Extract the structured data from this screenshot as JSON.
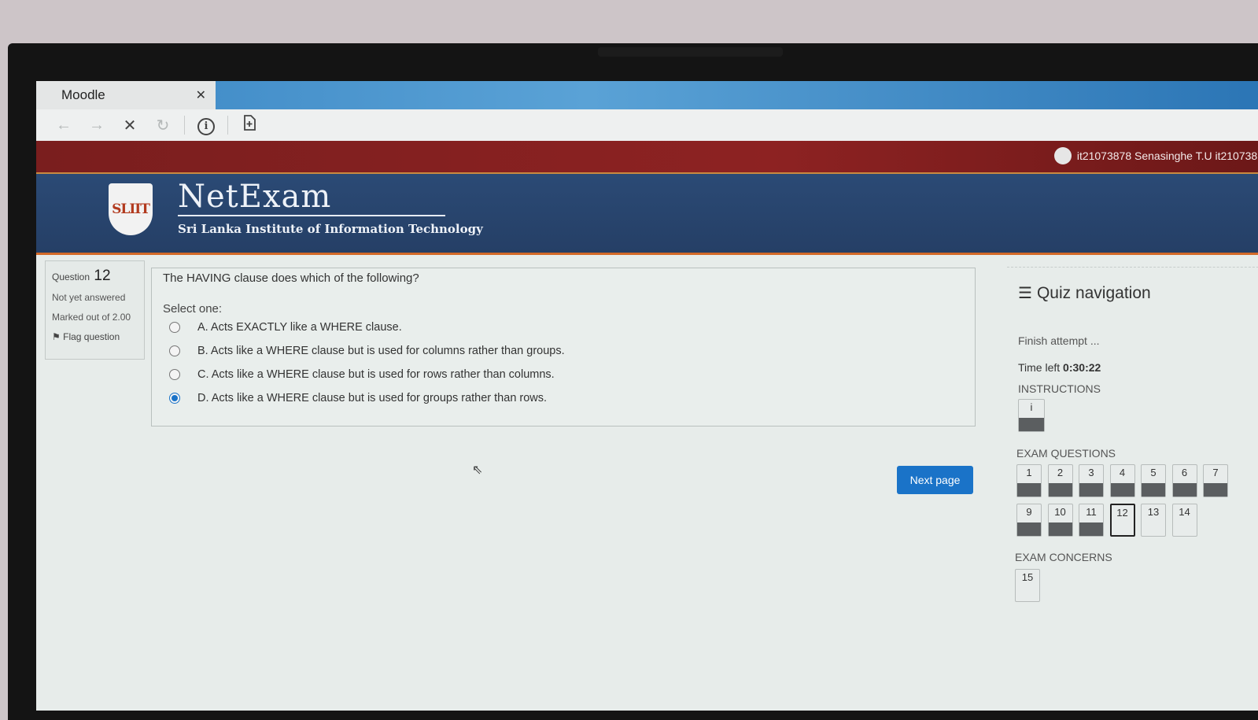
{
  "browser": {
    "tab_title": "Moodle",
    "tab_close": "✕",
    "nav_icons": [
      "back-arrow-icon",
      "forward-arrow-icon",
      "stop-icon",
      "reload-icon",
      "info-icon",
      "page-icon"
    ]
  },
  "header": {
    "user": "it21073878 Senasinghe T.U it2107387",
    "brand": "NetExam",
    "subtitle": "Sri Lanka Institute of Information Technology",
    "logo_text": "SLIIT"
  },
  "question_info": {
    "label": "Question",
    "number": "12",
    "state": "Not yet answered",
    "marked": "Marked out of 2.00",
    "flag_label": "Flag question"
  },
  "question": {
    "text": "The HAVING clause does which of the following?",
    "prompt": "Select one:",
    "options": [
      {
        "label": "A. Acts EXACTLY like a WHERE clause.",
        "selected": false
      },
      {
        "label": "B. Acts like a WHERE clause but is used for columns rather than groups.",
        "selected": false
      },
      {
        "label": "C. Acts like a WHERE clause but is used for rows rather than columns.",
        "selected": false
      },
      {
        "label": "D. Acts like a WHERE clause but is used for groups rather than rows.",
        "selected": true
      }
    ]
  },
  "actions": {
    "next_label": "Next page"
  },
  "quiz_nav": {
    "title": "Quiz navigation",
    "finish": "Finish attempt ...",
    "time_label": "Time left",
    "time_value": "0:30:22",
    "instructions_label": "INSTRUCTIONS",
    "instructions_btn": "i",
    "exam_questions_label": "EXAM QUESTIONS",
    "questions": [
      "1",
      "2",
      "3",
      "4",
      "5",
      "6",
      "7",
      "9",
      "10",
      "11",
      "12",
      "13",
      "14"
    ],
    "current": "12",
    "exam_concerns_label": "EXAM CONCERNS",
    "concerns": [
      "15"
    ]
  }
}
